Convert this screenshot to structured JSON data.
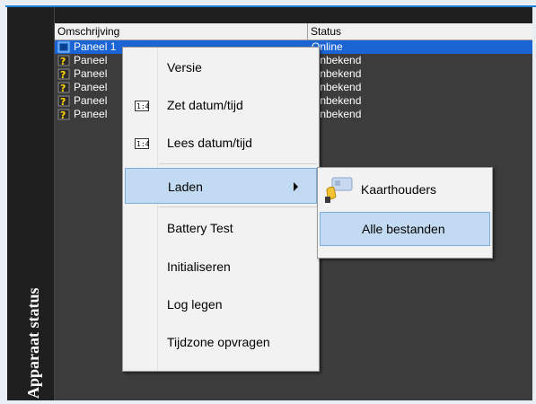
{
  "side_title": "Apparaat status",
  "table": {
    "columns": [
      "Omschrijving",
      "Status"
    ],
    "rows": [
      {
        "name": "Paneel 1",
        "status": "Online",
        "selected": true
      },
      {
        "name": "Paneel",
        "status": "Onbekend",
        "selected": false
      },
      {
        "name": "Paneel",
        "status": "Onbekend",
        "selected": false
      },
      {
        "name": "Paneel",
        "status": "Onbekend",
        "selected": false
      },
      {
        "name": "Paneel",
        "status": "Onbekend",
        "selected": false
      },
      {
        "name": "Paneel",
        "status": "Onbekend",
        "selected": false
      }
    ]
  },
  "context_menu": {
    "items": [
      {
        "label": "Versie",
        "icon": ""
      },
      {
        "label": "Zet datum/tijd",
        "icon": "clock-icon"
      },
      {
        "label": "Lees datum/tijd",
        "icon": "clock-icon"
      },
      {
        "label": "Laden",
        "icon": "",
        "submenu": true,
        "highlighted": true
      },
      {
        "label": "Battery Test",
        "icon": ""
      },
      {
        "label": "Initialiseren",
        "icon": ""
      },
      {
        "label": "Log legen",
        "icon": ""
      },
      {
        "label": "Tijdzone opvragen",
        "icon": ""
      }
    ]
  },
  "submenu": {
    "items": [
      {
        "label": "Kaarthouders",
        "icon": "cardholder-icon"
      },
      {
        "label": "Alle bestanden",
        "icon": "",
        "highlighted": true
      }
    ]
  },
  "colors": {
    "selection": "#1b64d4",
    "menu_highlight": "#c3dbf2",
    "accent": "#1f80d6"
  }
}
